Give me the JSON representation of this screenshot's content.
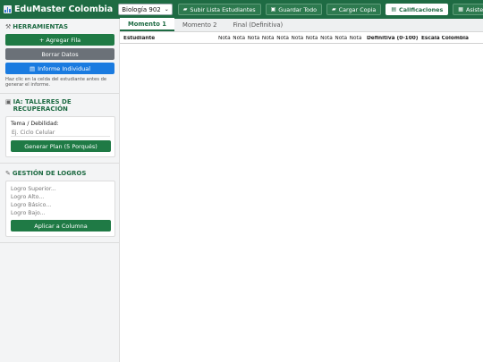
{
  "app": {
    "title": "EduMaster Colombia",
    "course": "Biología 902"
  },
  "toolbar": {
    "buttons": [
      {
        "label": "Subir Lista Estudiantes",
        "icon": "folder-icon"
      },
      {
        "label": "Guardar Todo",
        "icon": "save-icon"
      },
      {
        "label": "Cargar Copia",
        "icon": "folder-open-icon"
      },
      {
        "label": "Calificaciones",
        "icon": "notes-icon",
        "active": true
      },
      {
        "label": "Asistencia",
        "icon": "calendar-icon"
      }
    ]
  },
  "sidebar": {
    "herramientas": {
      "title": "HERRAMIENTAS",
      "add_row": "+ Agregar Fila",
      "clear": "Borrar Datos",
      "report": "Informe Individual",
      "hint": "Haz clic en la celda del estudiante antes de generar el informe."
    },
    "talleres": {
      "title": "IA: TALLERES DE RECUPERACIÓN",
      "topic_label": "Tema / Debilidad:",
      "topic_placeholder": "Ej. Ciclo Celular",
      "generate": "Generar Plan (5 Porqués)"
    },
    "logros": {
      "title": "GESTIÓN DE LOGROS",
      "fields": [
        "Logro Superior...",
        "Logro Alto...",
        "Logro Básico...",
        "Logro Bajo..."
      ],
      "apply": "Aplicar a Columna"
    }
  },
  "main": {
    "tabs": [
      "Momento 1",
      "Momento 2",
      "Final (Definitiva)"
    ],
    "active_tab": 0,
    "columns": {
      "student": "Estudiante",
      "notas": [
        "Nota",
        "Nota",
        "Nota",
        "Nota",
        "Nota",
        "Nota",
        "Nota",
        "Nota",
        "Nota",
        "Nota"
      ],
      "definitiva": "Definitiva (0-100)",
      "escala": "Escala Colombia"
    }
  },
  "colors": {
    "brand_green": "#1e6b43",
    "primary_blue": "#1a7be0",
    "neutral_gray": "#6b7178"
  }
}
